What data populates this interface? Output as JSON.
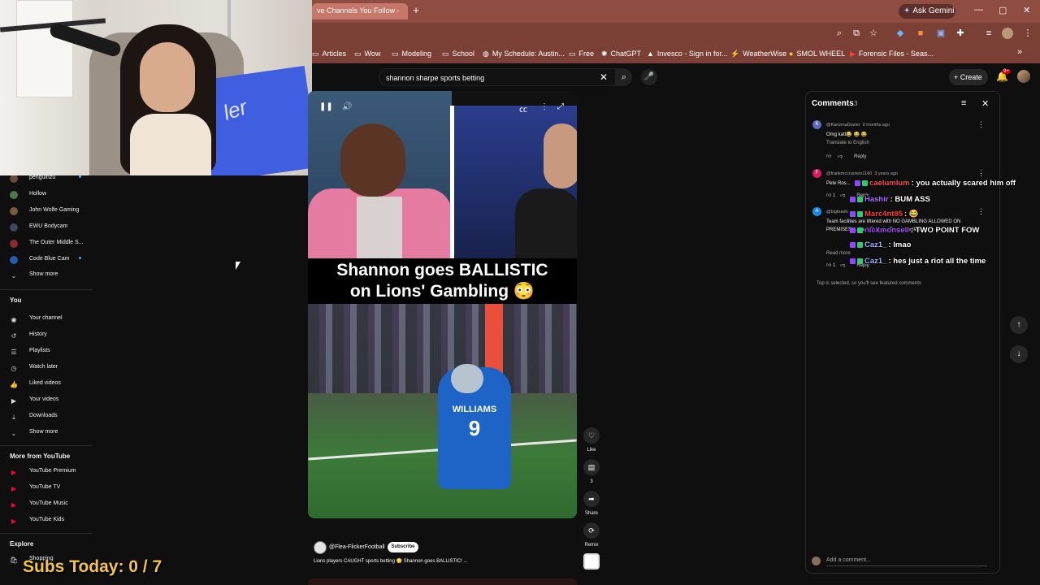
{
  "browser": {
    "tab_title": "ve Channels You Follow -",
    "new_tab": "+",
    "gemini_label": "Ask Gemini",
    "window_controls": [
      "—",
      "▢",
      "✕"
    ],
    "bookmarks": [
      {
        "label": "Articles",
        "icon": "folder-icon"
      },
      {
        "label": "Wow",
        "icon": "folder-icon"
      },
      {
        "label": "Modeling",
        "icon": "folder-icon"
      },
      {
        "label": "School",
        "icon": "folder-icon"
      },
      {
        "label": "My Schedule: Austin...",
        "icon": "globe-icon"
      },
      {
        "label": "Free",
        "icon": "folder-icon"
      },
      {
        "label": "ChatGPT",
        "icon": "chatgpt-icon"
      },
      {
        "label": "Invesco - Sign in for...",
        "icon": "invesco-icon"
      },
      {
        "label": "WeatherWise",
        "icon": "weather-icon"
      },
      {
        "label": "SMOL WHEEL",
        "icon": "wheel-icon"
      },
      {
        "label": "Forensic Files - Seas...",
        "icon": "youtube-icon"
      }
    ],
    "bookmarks_overflow": "»"
  },
  "youtube": {
    "search_value": "shannon sharpe sports betting",
    "create_label": "Create",
    "notif_badge": "9+"
  },
  "sidebar": {
    "subscriptions": [
      {
        "label": "penguinzu",
        "color": "#6b4a3a",
        "dot": true
      },
      {
        "label": "Hollow",
        "color": "#4a7a4a",
        "dot": false
      },
      {
        "label": "John Wolfe Gaming",
        "color": "#7a5a3a",
        "dot": false
      },
      {
        "label": "EWU Bodycam",
        "color": "#3a4a5a",
        "dot": false
      },
      {
        "label": "The Outer Middle S...",
        "color": "#8a2a2a",
        "dot": false
      },
      {
        "label": "Code Blue Cam",
        "color": "#2a5aaa",
        "dot": true
      }
    ],
    "show_more_1": "Show more",
    "you_heading": "You",
    "you_items": [
      {
        "label": "Your channel",
        "icon": "user-icon"
      },
      {
        "label": "History",
        "icon": "history-icon"
      },
      {
        "label": "Playlists",
        "icon": "playlist-icon"
      },
      {
        "label": "Watch later",
        "icon": "clock-icon"
      },
      {
        "label": "Liked videos",
        "icon": "thumb-up-icon"
      },
      {
        "label": "Your videos",
        "icon": "video-icon"
      },
      {
        "label": "Downloads",
        "icon": "download-icon"
      }
    ],
    "show_more_2": "Show more",
    "more_heading": "More from YouTube",
    "more_items": [
      {
        "label": "YouTube Premium"
      },
      {
        "label": "YouTube TV"
      },
      {
        "label": "YouTube Music"
      },
      {
        "label": "YouTube Kids"
      }
    ],
    "explore_heading": "Explore",
    "explore_items": [
      {
        "label": "Shopping"
      }
    ]
  },
  "overlay": {
    "subs_today": "Subs Today: 0 / 7"
  },
  "short": {
    "caption_line1": "Shannon goes BALLISTIC",
    "caption_line2": "on Lions' Gambling 😳",
    "jersey_name": "WILLIAMS",
    "jersey_number": "9",
    "channel": "@Flea-FlickerFootball",
    "subscribe_label": "Subscribe",
    "title": "Lions players CAUGHT sports betting 😳 Shannon goes BALLISTIC! ..."
  },
  "rail": {
    "like_label": "Like",
    "comments_count": "3",
    "share_label": "Share",
    "remix_label": "Remix"
  },
  "comments": {
    "title": "Comments",
    "count": "3",
    "items": [
      {
        "user": "@KarizmaDozier",
        "time": "9 months ago",
        "text": "Omg katt😂 😂 😂",
        "link": "Translate to English",
        "likes": "",
        "reply": "Reply",
        "av_color": "#5c6bc0",
        "av_letter": "K"
      },
      {
        "user": "@frankmccracken1160",
        "time": "3 years ago",
        "text": "Pete Ros...",
        "link": "",
        "likes": "1",
        "reply": "Reply",
        "av_color": "#d81b60",
        "av_letter": "F"
      },
      {
        "user": "@bigteado",
        "time": "",
        "text": "Team facilities are littered with NO GAMBLING ALLOWED ON PREMISES ... the NFL & the Team's facilities....",
        "link": "Read more",
        "likes": "1",
        "reply": "Reply",
        "av_color": "#1e88e5",
        "av_letter": "A"
      }
    ],
    "note": "Top is selected, so you'll see featured comments",
    "add_placeholder": "Add a comment..."
  },
  "chat": [
    {
      "user": "caelumlum",
      "text": ": you actually scared him off",
      "color": "#ff4f4f"
    },
    {
      "user": "Hashir",
      "text": ": BUM ASS",
      "color": "#b06cff"
    },
    {
      "user": "Marc4nt85",
      "text": ": 😂",
      "color": "#ff3b3b"
    },
    {
      "user": "nickmonsell",
      "text": ": TWO POINT FOW",
      "color": "#a64dff"
    },
    {
      "user": "Caz1_",
      "text": ": lmao",
      "color": "#9ab3ff"
    },
    {
      "user": "Caz1_",
      "text": ": hes just a riot all the time",
      "color": "#9ab3ff"
    }
  ]
}
